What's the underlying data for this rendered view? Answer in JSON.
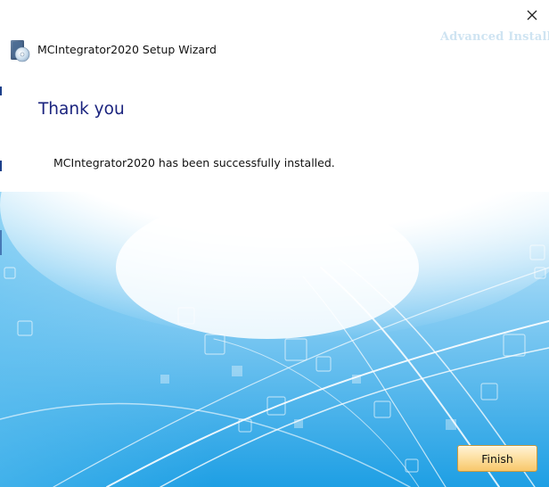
{
  "window": {
    "title": "MCIntegrator2020 Setup Wizard",
    "watermark": "Advanced Installer",
    "close_icon": "close-icon"
  },
  "content": {
    "heading": "Thank you",
    "message": "MCIntegrator2020 has been successfully installed."
  },
  "buttons": {
    "finish_label": "Finish"
  },
  "colors": {
    "heading": "#1a237e",
    "accent_blue": "#29a8e8",
    "button_top": "#fff3d6",
    "button_bottom": "#f8c76a"
  }
}
